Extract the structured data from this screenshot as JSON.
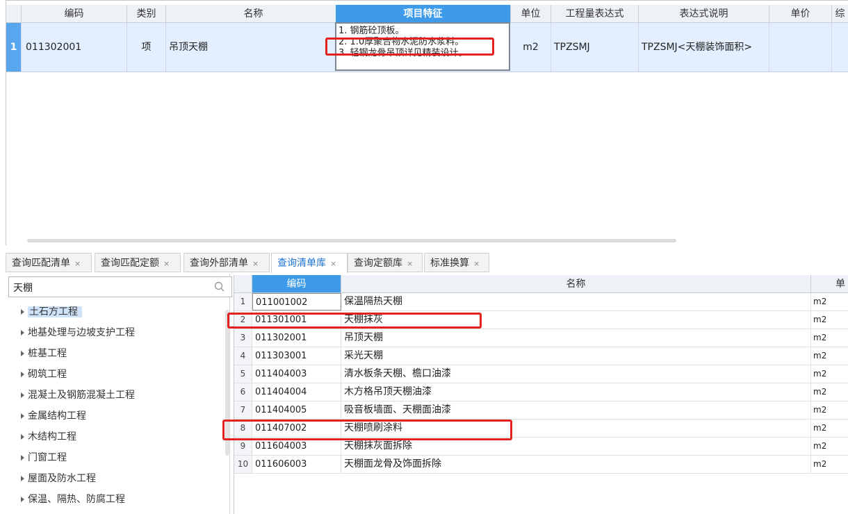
{
  "top_table": {
    "headers": {
      "code": "编码",
      "category": "类别",
      "name": "名称",
      "features": "项目特征",
      "unit": "单位",
      "quantity_expr": "工程量表达式",
      "expr_desc": "表达式说明",
      "unit_price": "单价",
      "extra": "综"
    },
    "row": {
      "num": "1",
      "code": "011302001",
      "category": "项",
      "name": "吊顶天棚",
      "features": [
        "1.  钢筋砼顶板。",
        "2.  1.0厚聚合物水泥防水浆料。",
        "3.  轻钢龙骨吊顶详见精装设计。"
      ],
      "unit": "m2",
      "quantity_expr": "TPZSMJ",
      "expr_desc": "TPZSMJ<天棚装饰面积>"
    }
  },
  "tabs": [
    {
      "label": "查询匹配清单",
      "close": "×"
    },
    {
      "label": "查询匹配定额",
      "close": "×"
    },
    {
      "label": "查询外部清单",
      "close": "×"
    },
    {
      "label": "查询清单库",
      "close": "×"
    },
    {
      "label": "查询定额库",
      "close": "×"
    },
    {
      "label": "标准换算",
      "close": "×"
    }
  ],
  "active_tab": "查询清单库",
  "search": {
    "value": "天棚"
  },
  "tree": [
    "土石方工程",
    "地基处理与边坡支护工程",
    "桩基工程",
    "砌筑工程",
    "混凝土及钢筋混凝土工程",
    "金属结构工程",
    "木结构工程",
    "门窗工程",
    "屋面及防水工程",
    "保温、隔热、防腐工程"
  ],
  "result_table": {
    "headers": {
      "code": "编码",
      "name": "名称",
      "unit": "单"
    },
    "rows": [
      {
        "num": "1",
        "code": "011001002",
        "name": "保温隔热天棚",
        "unit": "m2"
      },
      {
        "num": "2",
        "code": "011301001",
        "name": "天棚抹灰",
        "unit": "m2"
      },
      {
        "num": "3",
        "code": "011302001",
        "name": "吊顶天棚",
        "unit": "m2"
      },
      {
        "num": "4",
        "code": "011303001",
        "name": "采光天棚",
        "unit": "m2"
      },
      {
        "num": "5",
        "code": "011404003",
        "name": "清水板条天棚、檐口油漆",
        "unit": "m2"
      },
      {
        "num": "6",
        "code": "011404004",
        "name": "木方格吊顶天棚油漆",
        "unit": "m2"
      },
      {
        "num": "7",
        "code": "011404005",
        "name": "吸音板墙面、天棚面油漆",
        "unit": "m2"
      },
      {
        "num": "8",
        "code": "011407002",
        "name": "天棚喷刷涂料",
        "unit": "m2"
      },
      {
        "num": "9",
        "code": "011604003",
        "name": "天棚抹灰面拆除",
        "unit": "m2"
      },
      {
        "num": "10",
        "code": "011606003",
        "name": "天棚面龙骨及饰面拆除",
        "unit": "m2"
      }
    ]
  },
  "colors": {
    "accent": "#3d9be9",
    "highlight_box": "#e3221f",
    "selected_row": "#e3efff"
  }
}
